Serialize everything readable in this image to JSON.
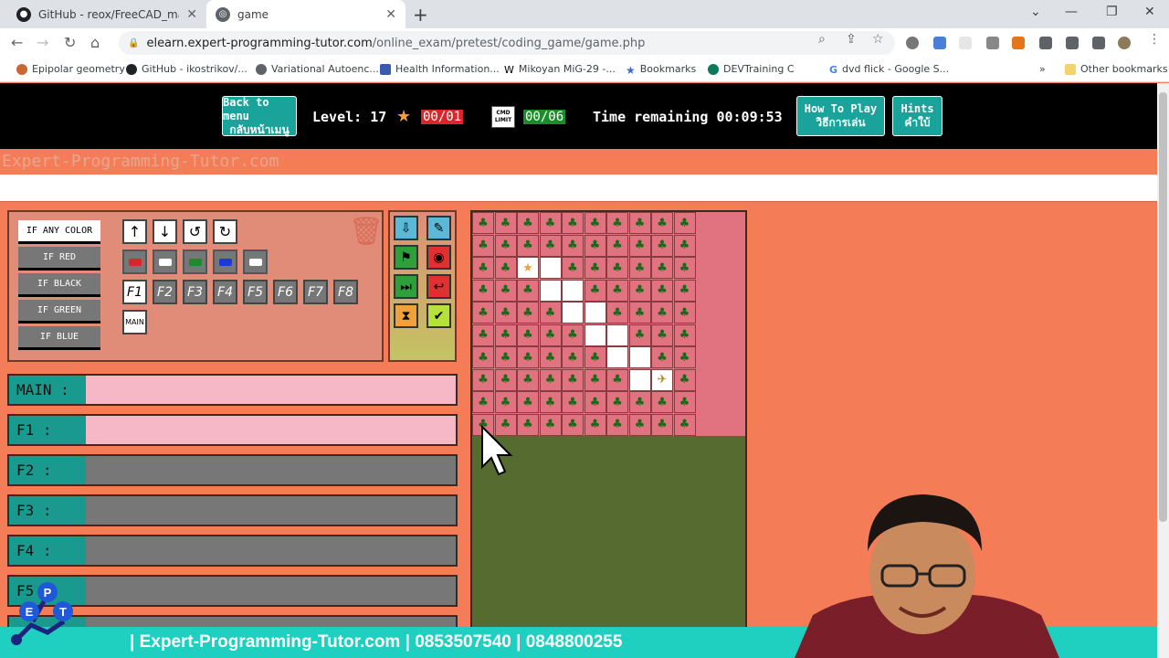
{
  "browser": {
    "tabs": [
      {
        "title": "GitHub - reox/FreeCAD_macros",
        "favicon": "github-icon"
      },
      {
        "title": "game",
        "favicon": "globe-icon"
      }
    ],
    "url_host": "elearn.expert-programming-tutor.com",
    "url_path": "/online_exam/pretest/coding_game/game.php",
    "bookmarks": [
      "Epipolar geometry",
      "GitHub - ikostrikov/...",
      "Variational Autoenc...",
      "Health Information...",
      "Mikoyan MiG-29 -...",
      "Bookmarks",
      "DEVTraining C",
      "dvd flick - Google S..."
    ],
    "other_bookmarks": "Other bookmarks",
    "overflow": "»"
  },
  "game": {
    "back_line1": "Back to menu",
    "back_line2": "กลับหน้าเมนู",
    "level_label": "Level: 17",
    "stars": "00/01",
    "cmd_line1": "CMD",
    "cmd_line2": "LIMIT",
    "cmd_count": "00/06",
    "time_label": "Time remaining 00:09:53",
    "howto_line1": "How To Play",
    "howto_line2": "วิธีการเล่น",
    "hints_line1": "Hints",
    "hints_line2": "คำใบ้",
    "watermark": "Expert-Programming-Tutor.com"
  },
  "palette": {
    "conditions": [
      "IF ANY COLOR",
      "IF RED",
      "IF BLACK",
      "IF GREEN",
      "IF BLUE"
    ],
    "functions": [
      "F1",
      "F2",
      "F3",
      "F4",
      "F5",
      "F6",
      "F7",
      "F8"
    ],
    "main": "MAIN",
    "paint_colors": [
      "#d8262c",
      "#ffffff",
      "#1a8c29",
      "#1a3bd8",
      "#ffffff"
    ]
  },
  "rows": [
    {
      "label": "MAIN :",
      "state": "pink"
    },
    {
      "label": "F1 :",
      "state": "pink"
    },
    {
      "label": "F2 :",
      "state": "gray"
    },
    {
      "label": "F3 :",
      "state": "gray"
    },
    {
      "label": "F4 :",
      "state": "gray"
    },
    {
      "label": "F5 :",
      "state": "gray"
    }
  ],
  "board": {
    "open_cells": [
      [
        2,
        2
      ],
      [
        2,
        3
      ],
      [
        3,
        3
      ],
      [
        3,
        4
      ],
      [
        4,
        4
      ],
      [
        4,
        5
      ],
      [
        5,
        5
      ],
      [
        5,
        6
      ],
      [
        6,
        6
      ],
      [
        6,
        7
      ],
      [
        7,
        7
      ],
      [
        7,
        8
      ]
    ],
    "star_cell": [
      2,
      2
    ],
    "plane_cell": [
      7,
      8
    ],
    "tree": "♣",
    "star": "★",
    "plane": "✈"
  },
  "banner": "| Expert-Programming-Tutor.com   | 0853507540 | 0848800255",
  "logo_letters": [
    "P",
    "E",
    "T"
  ]
}
